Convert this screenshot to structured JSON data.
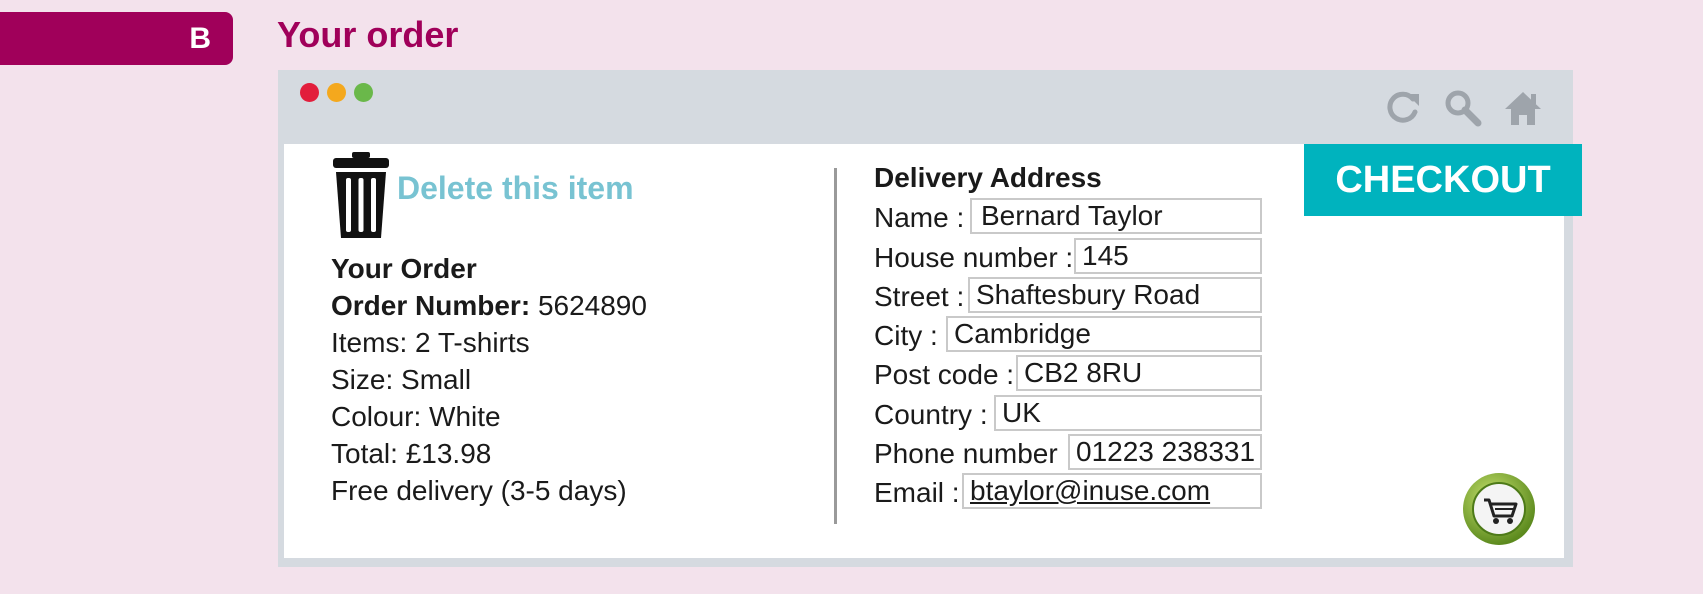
{
  "section": {
    "letter": "B",
    "title": "Your order"
  },
  "browser": {
    "toolbar_icons": [
      "refresh-icon",
      "search-icon",
      "home-icon"
    ]
  },
  "order": {
    "delete_label": "Delete this item",
    "heading": "Your Order",
    "number_label": "Order Number:",
    "number_value": "5624890",
    "items": "Items: 2 T-shirts",
    "size": "Size: Small",
    "colour": "Colour: White",
    "total": "Total: £13.98",
    "delivery": "Free delivery (3-5 days)"
  },
  "address": {
    "title": "Delivery Address",
    "fields": {
      "name": {
        "label": "Name :",
        "value": "Bernard Taylor"
      },
      "house": {
        "label": "House number :",
        "value": "145"
      },
      "street": {
        "label": "Street :",
        "value": "Shaftesbury Road"
      },
      "city": {
        "label": "City :",
        "value": "Cambridge"
      },
      "postcode": {
        "label": "Post code :",
        "value": "CB2 8RU"
      },
      "country": {
        "label": "Country :",
        "value": "UK"
      },
      "phone": {
        "label": "Phone number :",
        "value": "01223 238331"
      },
      "email": {
        "label": "Email :",
        "value": "btaylor@inuse.com"
      }
    }
  },
  "checkout_label": "CHECKOUT",
  "colors": {
    "accent": "#a0005a",
    "checkout": "#00b3be",
    "delete_link": "#78c3d2",
    "background": "#f3e2ec"
  }
}
